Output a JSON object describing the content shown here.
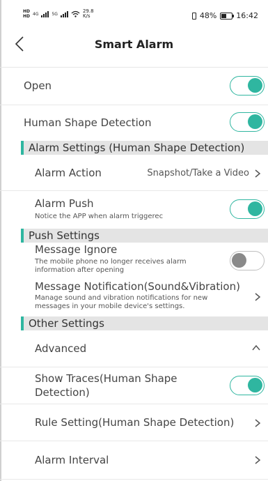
{
  "statusbar": {
    "left_top": "HD",
    "left_bottom": "HD",
    "sig1_tag": "4G",
    "sig2_tag": "5G",
    "speed_value": "29.8",
    "speed_unit": "K/s",
    "battery_text": "48%",
    "battery_level": 0.48,
    "time": "16:42"
  },
  "header": {
    "title": "Smart Alarm"
  },
  "rows": {
    "open": {
      "label": "Open",
      "on": true
    },
    "human_shape": {
      "label": "Human Shape Detection",
      "on": true
    },
    "alarm_action": {
      "label": "Alarm Action",
      "value": "Snapshot/Take a Video"
    },
    "alarm_push": {
      "label": "Alarm Push",
      "sub": "Notice the APP when alarm triggerec",
      "on": true
    },
    "message_ignore": {
      "label": "Message Ignore",
      "sub": "The mobile phone no longer receives alarm information after opening",
      "on": false
    },
    "message_notification": {
      "label": "Message Notification(Sound&Vibration)",
      "sub": "Manage sound and vibration notifications for new messages in your mobile device's settings."
    },
    "advanced": {
      "label": "Advanced"
    },
    "show_traces": {
      "label": "Show Traces(Human Shape Detection)",
      "on": true
    },
    "rule_setting": {
      "label": "Rule Setting(Human Shape Detection)"
    },
    "alarm_interval": {
      "label": "Alarm Interval"
    }
  },
  "sections": {
    "alarm_settings": "Alarm Settings (Human Shape Detection)",
    "push_settings": "Push Settings",
    "other_settings": "Other Settings"
  },
  "colors": {
    "accent": "#2fb6a0",
    "toggle_off": "#8a8a8a",
    "section_bg": "#e4e4e4"
  }
}
